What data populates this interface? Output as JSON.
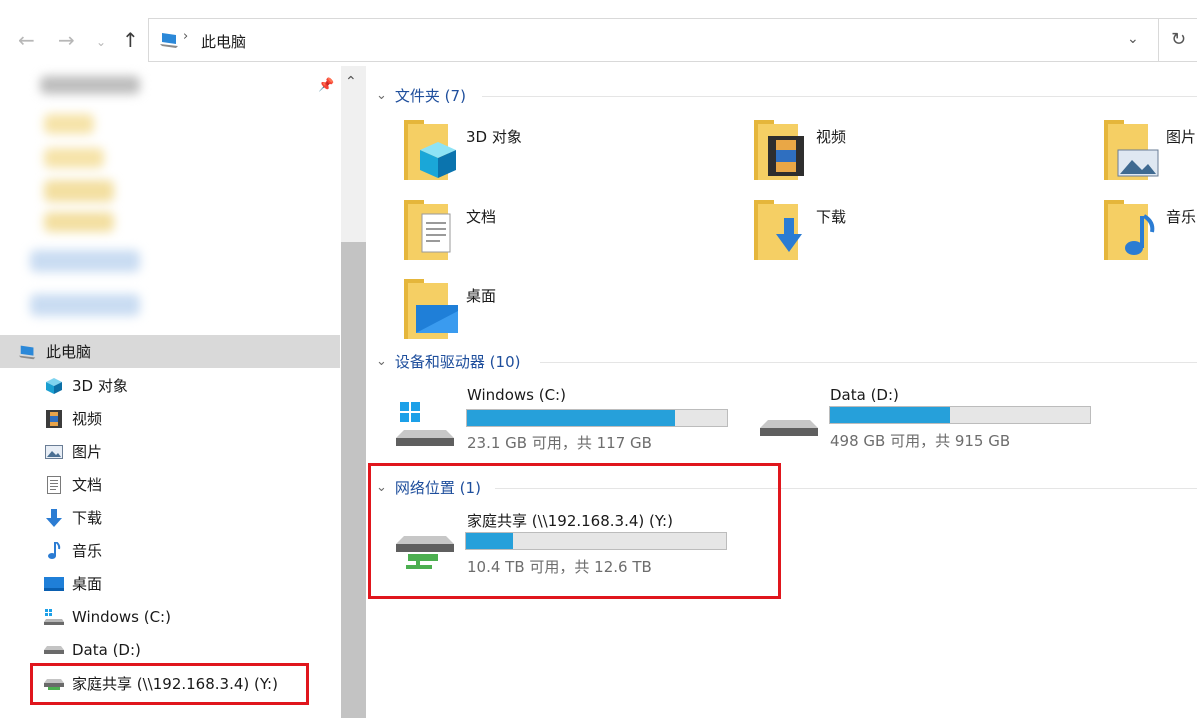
{
  "toolbar": {
    "back_icon": "arrow-left-icon",
    "forward_icon": "arrow-right-icon",
    "recent_icon": "chevron-down-icon",
    "up_icon": "arrow-up-icon",
    "breadcrumb_current": "此电脑",
    "refresh_icon": "refresh-icon"
  },
  "sidebar": {
    "items": [
      {
        "label": "此电脑",
        "icon": "computer-icon",
        "selected": true
      },
      {
        "label": "3D 对象",
        "icon": "cube-3d-icon"
      },
      {
        "label": "视频",
        "icon": "video-icon"
      },
      {
        "label": "图片",
        "icon": "picture-icon"
      },
      {
        "label": "文档",
        "icon": "document-icon"
      },
      {
        "label": "下载",
        "icon": "download-icon"
      },
      {
        "label": "音乐",
        "icon": "music-icon"
      },
      {
        "label": "桌面",
        "icon": "desktop-icon"
      },
      {
        "label": "Windows (C:)",
        "icon": "windows-drive-icon"
      },
      {
        "label": "Data (D:)",
        "icon": "drive-icon"
      },
      {
        "label": "家庭共享 (\\\\192.168.3.4) (Y:)",
        "icon": "network-drive-icon",
        "highlighted": true
      }
    ]
  },
  "main": {
    "folders_section": {
      "title": "文件夹 (7)"
    },
    "folders": [
      {
        "label": "3D 对象",
        "icon": "folder-3d-objects-icon"
      },
      {
        "label": "视频",
        "icon": "folder-video-icon"
      },
      {
        "label": "图片",
        "icon": "folder-pictures-icon"
      },
      {
        "label": "文档",
        "icon": "folder-documents-icon"
      },
      {
        "label": "下载",
        "icon": "folder-downloads-icon"
      },
      {
        "label": "音乐",
        "icon": "folder-music-icon"
      },
      {
        "label": "桌面",
        "icon": "folder-desktop-icon"
      }
    ],
    "devices_section": {
      "title": "设备和驱动器 (10)"
    },
    "drives": [
      {
        "name": "Windows (C:)",
        "free_text": "23.1 GB 可用，共 117 GB",
        "used_fraction": 0.8
      },
      {
        "name": "Data (D:)",
        "free_text": "498 GB 可用，共 915 GB",
        "used_fraction": 0.46
      }
    ],
    "network_section": {
      "title": "网络位置 (1)"
    },
    "network_drives": [
      {
        "name": "家庭共享 (\\\\192.168.3.4) (Y:)",
        "free_text": "10.4 TB 可用，共 12.6 TB",
        "used_fraction": 0.18
      }
    ]
  },
  "colors": {
    "accent": "#26a0da",
    "section_title": "#1e4e9c",
    "highlight_box": "#e0161d",
    "folder": "#f4c94e"
  }
}
